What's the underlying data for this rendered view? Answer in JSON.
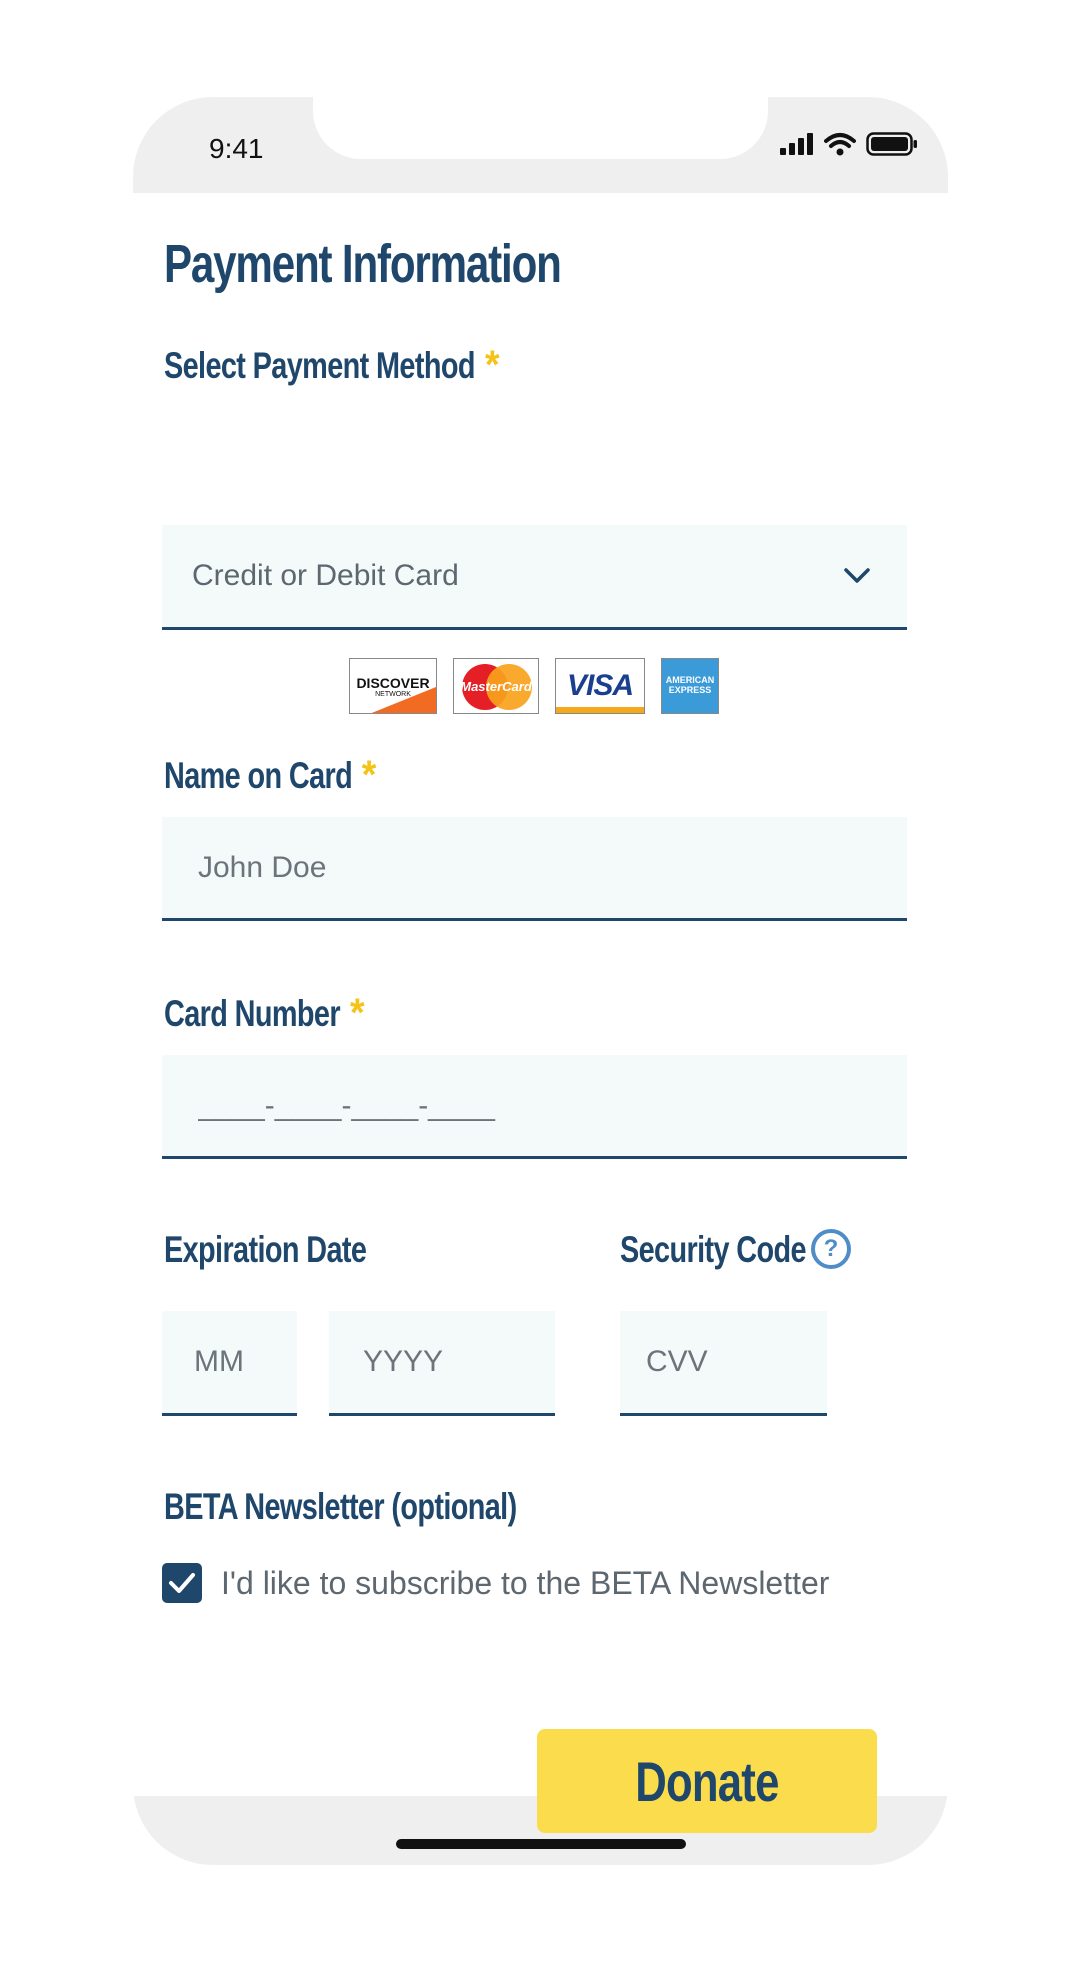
{
  "status_bar": {
    "time": "9:41"
  },
  "page": {
    "title": "Payment Information"
  },
  "payment_method": {
    "label": "Select Payment Method",
    "required_marker": "*",
    "selected_value": "Credit or Debit Card"
  },
  "accepted_cards": [
    {
      "name": "discover-card-logo",
      "text": "DISCOVER",
      "subtext": "NETWORK"
    },
    {
      "name": "mastercard-card-logo",
      "text": "MasterCard"
    },
    {
      "name": "visa-card-logo",
      "text": "VISA"
    },
    {
      "name": "amex-card-logo",
      "text": "AMERICAN",
      "subtext": "EXPRESS"
    }
  ],
  "name_on_card": {
    "label": "Name on Card",
    "required_marker": "*",
    "placeholder": "John Doe"
  },
  "card_number": {
    "label": "Card Number",
    "required_marker": "*",
    "placeholder": "____-____-____-____"
  },
  "expiration": {
    "label": "Expiration Date",
    "month_placeholder": "MM",
    "year_placeholder": "YYYY"
  },
  "security_code": {
    "label": "Security Code",
    "help_glyph": "?",
    "placeholder": "CVV"
  },
  "newsletter": {
    "label": "BETA Newsletter (optional)",
    "checkbox_label": "I'd like to subscribe to the BETA Newsletter",
    "checked": true
  },
  "actions": {
    "donate_label": "Donate"
  },
  "colors": {
    "primary": "#1f466b",
    "accent": "#fbdc4c",
    "required": "#f4c316",
    "field_bg": "#f4f9fa",
    "help": "#4f8dc8"
  }
}
